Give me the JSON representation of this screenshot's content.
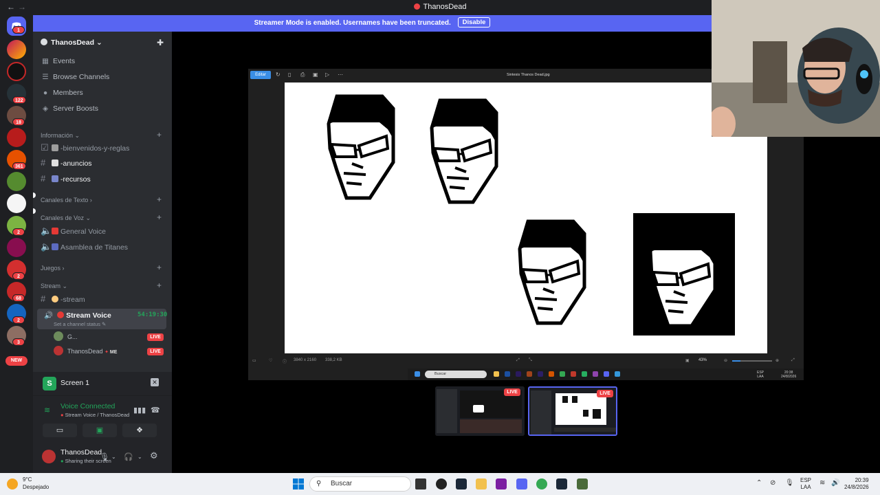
{
  "window": {
    "title": "ThanosDead",
    "back": "←",
    "forward": "→"
  },
  "banner": {
    "text": "Streamer Mode is enabled. Usernames have been truncated.",
    "button": "Disable"
  },
  "rail": {
    "badges": [
      "1",
      "122",
      "18",
      "361",
      "2",
      "2",
      "68",
      "2",
      "3"
    ],
    "new_label": "NEW"
  },
  "server": {
    "name": "ThanosDead",
    "chevron": "⌄"
  },
  "menu": [
    {
      "label": "Events",
      "icon": "calendar-icon"
    },
    {
      "label": "Browse Channels",
      "icon": "browse-icon"
    },
    {
      "label": "Members",
      "icon": "members-icon"
    },
    {
      "label": "Server Boosts",
      "icon": "boost-icon"
    }
  ],
  "categories": {
    "informacion": "Información",
    "texto": "Canales de Texto",
    "voz": "Canales de Voz",
    "juegos": "Juegos",
    "stream": "Stream"
  },
  "channels": {
    "bienvenidos": "-bienvenidos-y-reglas",
    "anuncios": "-anuncios",
    "recursos": "-recursos",
    "general_voice": "General Voice",
    "asamblea": "Asamblea de Titanes",
    "stream_text": "-stream",
    "stream_voice": "Stream Voice",
    "stream_timer": "54:19:30",
    "stream_status": "Set a channel status"
  },
  "members": [
    {
      "name": "G...",
      "live": "LIVE"
    },
    {
      "name": "ThanosDead",
      "tag": "ME",
      "live": "LIVE"
    }
  ],
  "screen_share": {
    "label": "Screen 1"
  },
  "voice": {
    "status": "Voice Connected",
    "location": "Stream Voice / ThanosDead"
  },
  "user": {
    "name": "ThanosDead",
    "status": "Sharing their screen"
  },
  "photo_viewer": {
    "edit_label": "Editar",
    "filename": "Sintesis Thanos Dead.jpg",
    "dimensions": "3840 x 2160",
    "filesize": "338,2 KB",
    "zoom": "43%",
    "search": "Buscar",
    "lang_top": "ESP",
    "lang_bottom": "LAA",
    "time": "20:38",
    "date": "24/8/2026"
  },
  "thumbnails": [
    {
      "live": "LIVE"
    },
    {
      "live": "LIVE"
    }
  ],
  "taskbar": {
    "temp": "9°C",
    "weather": "Despejado",
    "search": "Buscar",
    "lang_top": "ESP",
    "lang_bottom": "LAA",
    "time": "20:39",
    "date": "24/8/2026"
  },
  "colors": {
    "blurple": "#5865f2",
    "green": "#23a55a",
    "red": "#ed4245",
    "sidebar": "#2b2d31",
    "rail": "#1e1f22"
  }
}
